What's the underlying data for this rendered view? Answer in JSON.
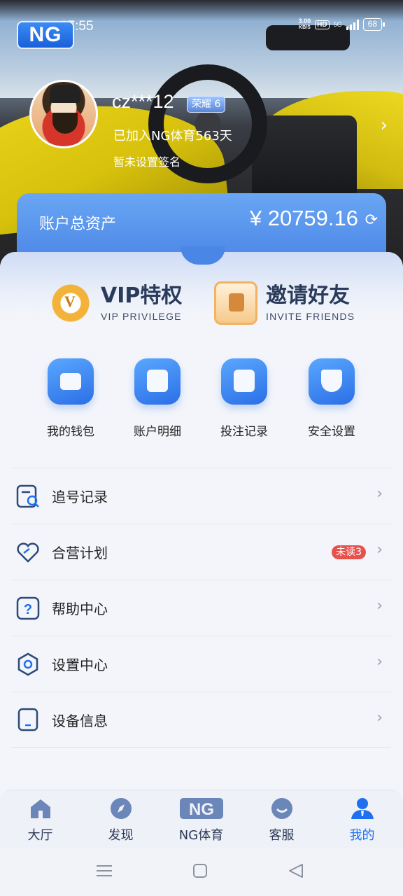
{
  "status_bar": {
    "time": "17:55",
    "net_speed_value": "3.00",
    "net_speed_unit": "KB/S",
    "hd": "HD",
    "network": "5G",
    "battery": "68"
  },
  "app_logo": "NG",
  "profile": {
    "username": "cz***12",
    "rank": "荣耀 6",
    "joined": "已加入NG体育563天",
    "signature": "暂未设置签名"
  },
  "assets": {
    "label": "账户总资产",
    "value": "¥ 20759.16"
  },
  "promos": [
    {
      "title": "VIP特权",
      "subtitle": "VIP PRIVILEGE",
      "icon": "vip-badge-icon"
    },
    {
      "title": "邀请好友",
      "subtitle": "INVITE FRIENDS",
      "icon": "invite-card-icon"
    }
  ],
  "quick_actions": [
    {
      "label": "我的钱包",
      "icon": "wallet-icon"
    },
    {
      "label": "账户明细",
      "icon": "account-detail-icon"
    },
    {
      "label": "投注记录",
      "icon": "bet-record-icon"
    },
    {
      "label": "安全设置",
      "icon": "shield-icon"
    }
  ],
  "menu": [
    {
      "label": "追号记录",
      "icon": "search-record-icon"
    },
    {
      "label": "合营计划",
      "icon": "handshake-heart-icon",
      "badge": "未读3"
    },
    {
      "label": "帮助中心",
      "icon": "help-icon"
    },
    {
      "label": "设置中心",
      "icon": "gear-icon"
    },
    {
      "label": "设备信息",
      "icon": "device-icon"
    }
  ],
  "tabs": [
    {
      "label": "大厅",
      "icon": "home-icon"
    },
    {
      "label": "发现",
      "icon": "compass-icon"
    },
    {
      "label": "NG体育",
      "icon": "ng-logo-icon"
    },
    {
      "label": "客服",
      "icon": "customer-service-icon"
    },
    {
      "label": "我的",
      "icon": "user-icon",
      "active": true
    }
  ],
  "colors": {
    "accent": "#1f6ff0",
    "badge": "#e8524d",
    "card": "#4a86e6"
  }
}
